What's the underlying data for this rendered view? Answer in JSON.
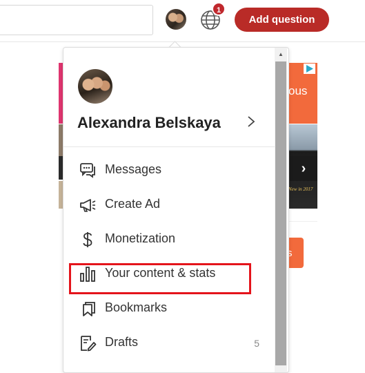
{
  "header": {
    "notification_count": "1",
    "add_question_label": "Add question"
  },
  "background": {
    "promo_text_fragment": "ous",
    "button_text_fragment": "s",
    "caption_fragment": "New in 2017"
  },
  "profile": {
    "name": "Alexandra Belskaya"
  },
  "menu": {
    "items": [
      {
        "label": "Messages",
        "icon": "messages-icon"
      },
      {
        "label": "Create Ad",
        "icon": "megaphone-icon"
      },
      {
        "label": "Monetization",
        "icon": "dollar-icon"
      },
      {
        "label": "Your content & stats",
        "icon": "stats-icon"
      },
      {
        "label": "Bookmarks",
        "icon": "bookmark-icon"
      },
      {
        "label": "Drafts",
        "icon": "drafts-icon",
        "count": "5"
      }
    ]
  },
  "colors": {
    "brand_red": "#b92b27",
    "highlight_red": "#e4141b",
    "promo_orange": "#f26a3c"
  }
}
